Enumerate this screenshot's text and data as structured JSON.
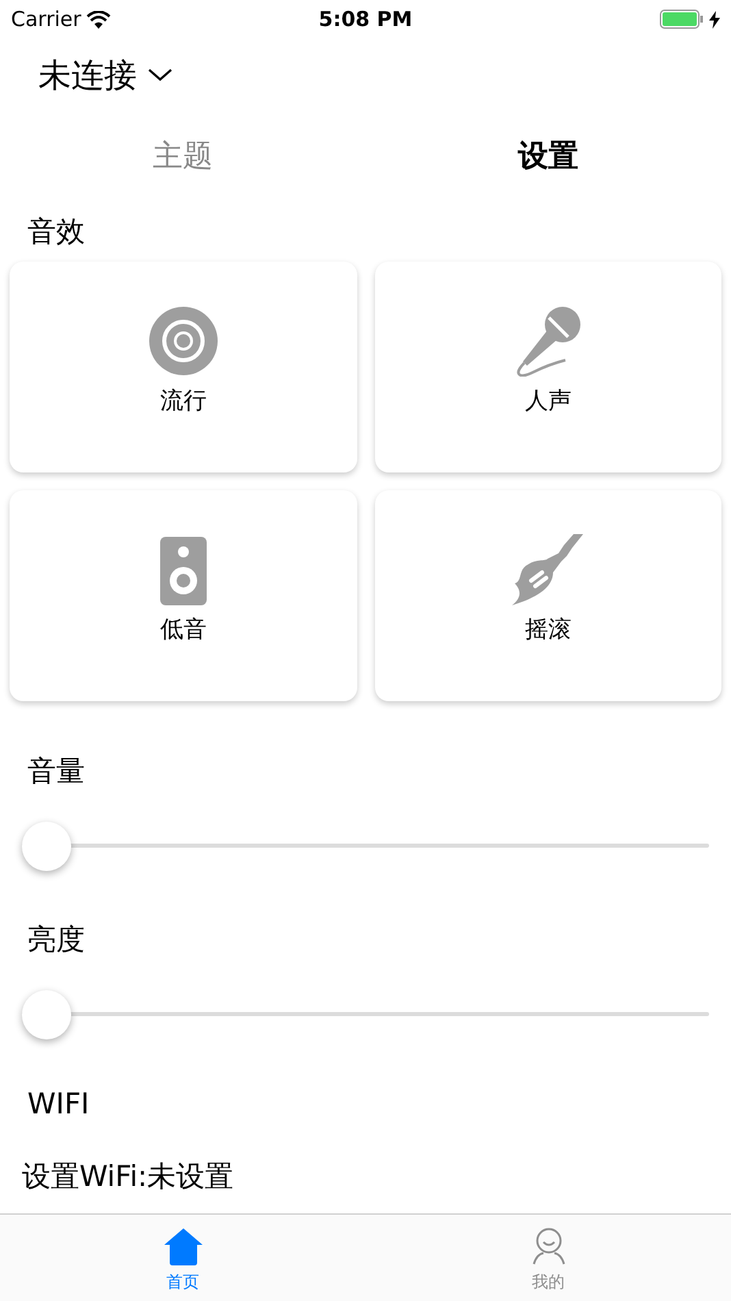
{
  "status_bar": {
    "carrier": "Carrier",
    "time": "5:08 PM"
  },
  "header": {
    "title": "未连接"
  },
  "tabs": [
    {
      "label": "主题",
      "selected": false
    },
    {
      "label": "设置",
      "selected": true
    }
  ],
  "effects": {
    "label": "音效",
    "items": [
      {
        "label": "流行",
        "kind": "disc"
      },
      {
        "label": "人声",
        "kind": "mic"
      },
      {
        "label": "低音",
        "kind": "speaker"
      },
      {
        "label": "摇滚",
        "kind": "guitar"
      }
    ]
  },
  "sliders": [
    {
      "label": "音量",
      "level": 0
    },
    {
      "label": "亮度",
      "level": 0
    }
  ],
  "wifi": {
    "label": "WIFI",
    "setting": "设置WiFi:未设置"
  },
  "tab_bar": [
    {
      "label": "首页",
      "kind": "home",
      "selected": true
    },
    {
      "label": "我的",
      "kind": "user",
      "selected": false
    }
  ]
}
